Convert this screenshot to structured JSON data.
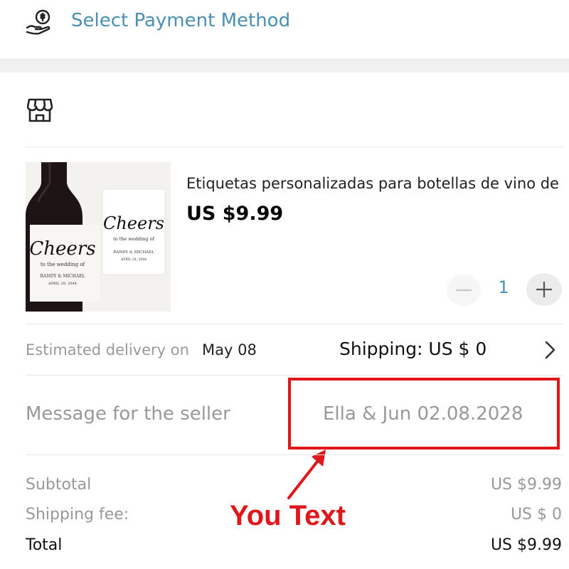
{
  "payment": {
    "icon": "hand-coin-icon",
    "label": "Select Payment Method"
  },
  "store": {
    "icon": "store-icon"
  },
  "product": {
    "title": "Etiquetas personalizadas para botellas de vino de",
    "price": "US $9.99",
    "image": {
      "icon": "wine-bottle-label-image",
      "script_text": "Cheers",
      "line1": "to the wedding of",
      "names": "RANDY & MICHAEL",
      "date": "APRIL 28, 2044"
    },
    "quantity": "1",
    "minus_icon": "minus-icon",
    "plus_icon": "plus-icon"
  },
  "delivery": {
    "label": "Estimated delivery on",
    "date": "May 08",
    "shipping": "Shipping: US $ 0",
    "chevron_icon": "chevron-right-icon"
  },
  "message": {
    "label": "Message for the seller",
    "value": "Ella & Jun 02.08.2028"
  },
  "annotation": {
    "text": "You Text",
    "color": "#e0161b"
  },
  "summary": {
    "subtotal_label": "Subtotal",
    "subtotal_value": "US $9.99",
    "shipping_fee_label": "Shipping fee:",
    "shipping_fee_value": "US $ 0",
    "total_label": "Total",
    "total_value": "US $9.99"
  },
  "colors": {
    "accent": "#4a8fb5",
    "annotation_red": "#e0161b",
    "muted_text": "#999999"
  }
}
